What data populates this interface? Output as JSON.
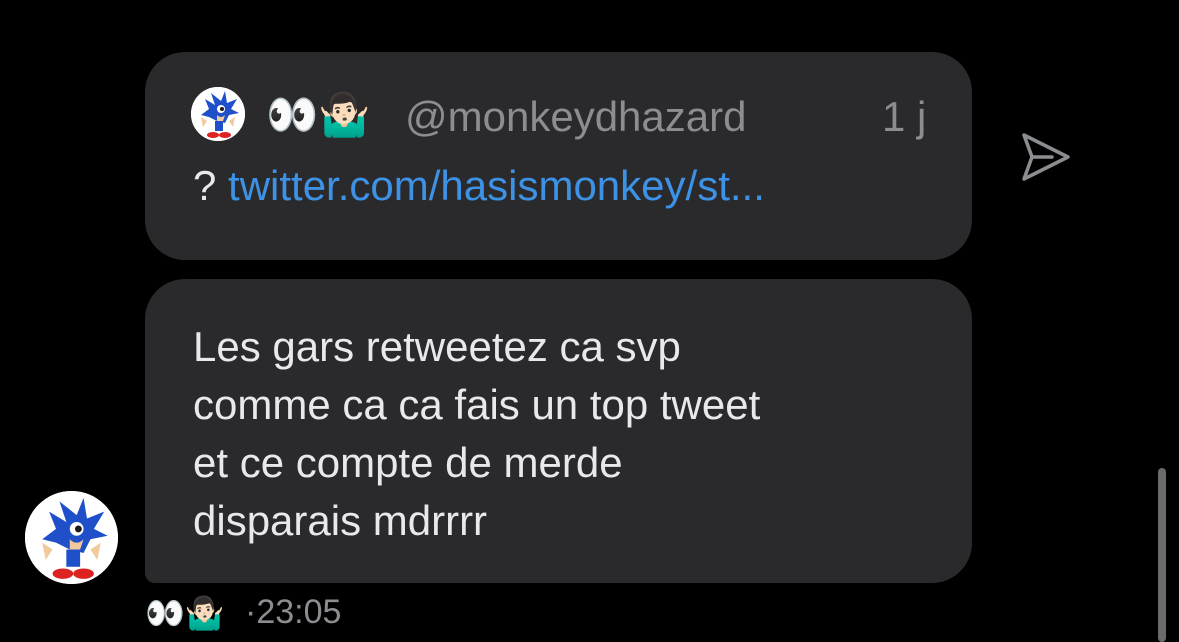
{
  "quoted_tweet": {
    "author_emoji": "👀🤷🏻‍♂️",
    "handle": "@monkeydhazard",
    "time": "1 j",
    "prefix": "?",
    "link": "twitter.com/hasismonkey/st..."
  },
  "message": {
    "lines": [
      "Les gars retweetez ca svp",
      "comme ca ca fais un top tweet",
      "et ce compte de merde",
      "disparais mdrrrr"
    ]
  },
  "meta": {
    "sender_emoji": "👀🤷🏻‍♂️",
    "time": "·23:05"
  },
  "icons": {
    "send": "send-icon",
    "avatar": "sonic-avatar"
  },
  "colors": {
    "background": "#000000",
    "bubble": "#2a2a2c",
    "link": "#3d92e6",
    "muted": "#8b8d91",
    "text": "#e7e9ea"
  }
}
